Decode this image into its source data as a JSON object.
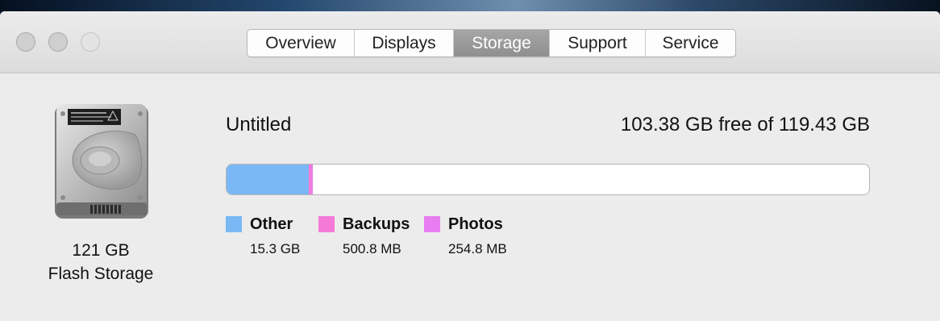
{
  "window": {
    "tabs": [
      {
        "label": "Overview",
        "active": false
      },
      {
        "label": "Displays",
        "active": false
      },
      {
        "label": "Storage",
        "active": true
      },
      {
        "label": "Support",
        "active": false
      },
      {
        "label": "Service",
        "active": false
      }
    ]
  },
  "disk": {
    "icon": "hard-drive-icon",
    "size": "121 GB",
    "type": "Flash Storage"
  },
  "volume": {
    "name": "Untitled",
    "free_text": "103.38 GB free of 119.43 GB"
  },
  "usage": {
    "total_gb": 119.43,
    "categories": [
      {
        "label": "Other",
        "size": "15.3 GB",
        "gb": 15.3,
        "color": "#7ab8f5"
      },
      {
        "label": "Backups",
        "size": "500.8 MB",
        "gb": 0.5008,
        "color": "#f57ad8"
      },
      {
        "label": "Photos",
        "size": "254.8 MB",
        "gb": 0.2548,
        "color": "#e77df0"
      }
    ]
  },
  "colors": {
    "active_tab": "#999999",
    "bar_border": "#b5b5b5"
  }
}
